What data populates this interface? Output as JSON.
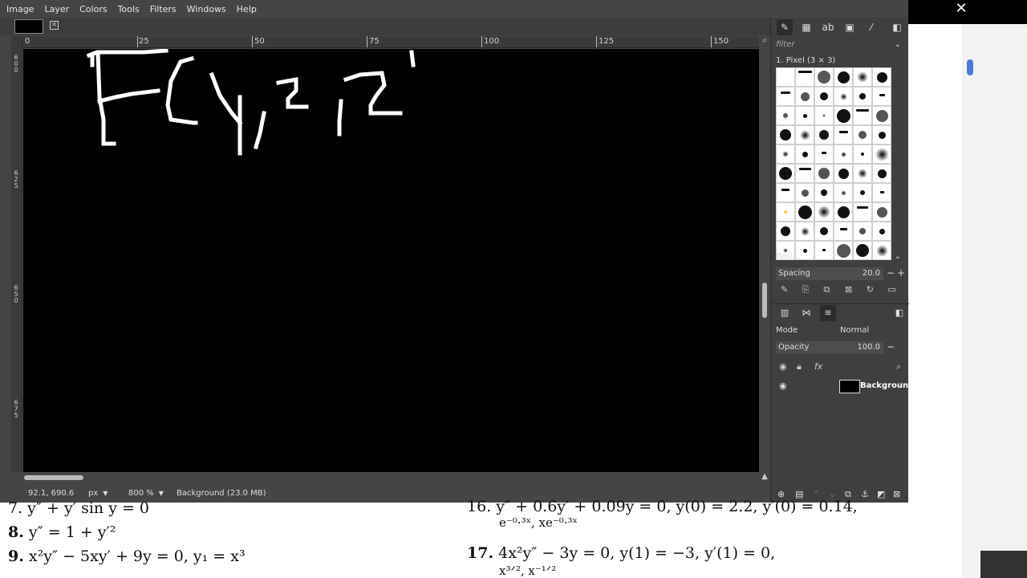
{
  "menu": [
    "Image",
    "Layer",
    "Colors",
    "Tools",
    "Filters",
    "Windows",
    "Help"
  ],
  "ruler": {
    "top_labels": [
      "0",
      "25",
      "50",
      "75",
      "100",
      "125",
      "150"
    ],
    "left_labels": [
      "6\n0\n0",
      "6\n2\n5",
      "6\n5\n0",
      "6\n7\n5"
    ]
  },
  "canvas": {
    "text_drawn": "F(y, z, z"
  },
  "status": {
    "coords": "92.1, 690.6",
    "unit": "px",
    "zoom": "800 %",
    "message": "Background (23.0 MB)"
  },
  "brushes": {
    "filter_placeholder": "filter",
    "selected_name": "1. Pixel (3 × 3)",
    "preset": "Basic,",
    "spacing_label": "Spacing",
    "spacing_value": "20.0"
  },
  "layers": {
    "mode_label": "Mode",
    "mode_value": "Normal",
    "opacity_label": "Opacity",
    "opacity_value": "100.0",
    "items": [
      {
        "name": "Backgroun"
      }
    ]
  },
  "document": {
    "l7": "7.  y″ + y′ sin y = 0",
    "l8_num": "8.",
    "l8": "y″ = 1 + y′²",
    "l9_num": "9.",
    "l9": "x²y″ − 5xy′ + 9y = 0,   y₁ = x³",
    "l16": "16.  y″ + 0.6y′ + 0.09y = 0,   y(0) = 2.2,  y′(0) = 0.14,",
    "l16b": "e⁻⁰·³ˣ, xe⁻⁰·³ˣ",
    "l17_num": "17.",
    "l17": "4x²y″ − 3y = 0,   y(1) = −3,   y′(1) = 0,",
    "l17b": "x³ᐟ², x⁻¹ᐟ²"
  }
}
